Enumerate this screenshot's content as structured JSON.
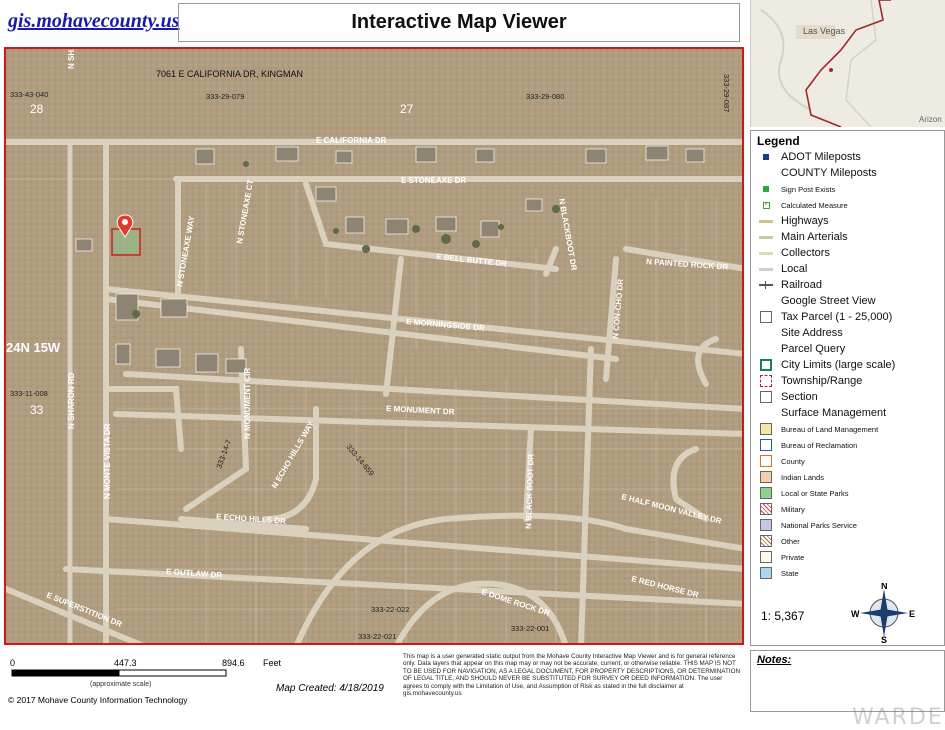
{
  "header": {
    "site_link": "gis.mohavecounty.us",
    "title": "Interactive Map Viewer"
  },
  "inset": {
    "city_label": "Las Vegas",
    "town_label": "Arizon"
  },
  "map": {
    "address": "7061 E CALIFORNIA DR, KINGMAN",
    "township": "24N 15W",
    "sections": [
      "28",
      "27",
      "33"
    ],
    "parcels": [
      "333-43-040",
      "333-29-079",
      "333-29-080",
      "333-29-087",
      "333-11-008",
      "333-14-7",
      "333-14-659",
      "333-22-022",
      "333-22-021",
      "333-22-001"
    ],
    "streets": [
      "E CALIFORNIA DR",
      "E STONEAXE DR",
      "E BELL BUTTE DR",
      "N PAINTED ROCK DR",
      "E MORNINGSIDE DR",
      "E MONUMENT DR",
      "E HALF MOON VALLEY DR",
      "E ECHO HILLS DR",
      "E OUTLAW DR",
      "E SUPERSTITION DR",
      "E RED HORSE DR",
      "E DOME ROCK DR",
      "N SHARON RD",
      "N MONTE VISTA DR",
      "N STONEAXE WAY",
      "N STONEAXE CT",
      "N BLACKBOOT DR",
      "N CON-CHO DR",
      "N MONUMENT CIR",
      "N ECHO HILLS WAY",
      "N BLACK BOOT DR"
    ]
  },
  "legend": {
    "title": "Legend",
    "items": [
      {
        "label": "ADOT Mileposts",
        "sym": "sq-blue",
        "size": "normal"
      },
      {
        "label": "COUNTY Mileposts",
        "sym": "none",
        "size": "normal"
      },
      {
        "label": "Sign Post Exists",
        "sym": "sq-green",
        "size": "small"
      },
      {
        "label": "Calculated Measure",
        "sym": "sq-green-x",
        "size": "small"
      },
      {
        "label": "Highways",
        "sym": "line-olive",
        "size": "normal"
      },
      {
        "label": "Main Arterials",
        "sym": "line-olive2",
        "size": "normal"
      },
      {
        "label": "Collectors",
        "sym": "line-lgreen",
        "size": "normal"
      },
      {
        "label": "Local",
        "sym": "line-gray",
        "size": "normal"
      },
      {
        "label": "Railroad",
        "sym": "line-rail",
        "size": "normal"
      },
      {
        "label": "Google Street View",
        "sym": "none",
        "size": "normal"
      },
      {
        "label": "Tax Parcel (1 - 25,000)",
        "sym": "box-gray",
        "size": "normal"
      },
      {
        "label": "Site Address",
        "sym": "none",
        "size": "normal"
      },
      {
        "label": "Parcel Query",
        "sym": "none",
        "size": "normal"
      },
      {
        "label": "City Limits (large scale)",
        "sym": "box-teal",
        "size": "normal"
      },
      {
        "label": "Township/Range",
        "sym": "box-red-dash",
        "size": "normal"
      },
      {
        "label": "Section",
        "sym": "box-gray",
        "size": "normal"
      },
      {
        "label": "Surface Management",
        "sym": "none",
        "size": "normal"
      },
      {
        "label": "Bureau of Land Management",
        "sym": "fill-yellow",
        "size": "small"
      },
      {
        "label": "Bureau of Reclamation",
        "sym": "fill-blue-outline",
        "size": "small"
      },
      {
        "label": "County",
        "sym": "fill-orange-outline",
        "size": "small"
      },
      {
        "label": "Indian Lands",
        "sym": "fill-peach",
        "size": "small"
      },
      {
        "label": "Local or State Parks",
        "sym": "fill-green",
        "size": "small"
      },
      {
        "label": "Military",
        "sym": "fill-red-hatch",
        "size": "small"
      },
      {
        "label": "National Parks Service",
        "sym": "fill-lavender",
        "size": "small"
      },
      {
        "label": "Other",
        "sym": "fill-brown-hatch",
        "size": "small"
      },
      {
        "label": "Private",
        "sym": "fill-white",
        "size": "small"
      },
      {
        "label": "State",
        "sym": "fill-lightblue",
        "size": "small"
      }
    ],
    "scale_ratio": "1: 5,367",
    "compass": {
      "n": "N",
      "s": "S",
      "e": "E",
      "w": "W"
    }
  },
  "scalebar": {
    "labels": [
      "0",
      "447.3",
      "894.6"
    ],
    "unit": "Feet",
    "note": "(approximate scale)"
  },
  "footer": {
    "copyright": "© 2017 Mohave County Information Technology",
    "map_created": "Map Created: 4/18/2019",
    "disclaimer": "This map is a user generated static output from the Mohave County Interactive Map Viewer and is for general reference only. Data layers that appear on this map may or may not be accurate, current, or otherwise reliable. THIS MAP IS NOT TO BE USED FOR NAVIGATION, AS A LEGAL DOCUMENT, FOR PROPERTY DESCRIPTIONS, OR DETERMINATION OF LEGAL TITLE, AND SHOULD NEVER BE SUBSTITUTED FOR SURVEY OR DEED INFORMATION. The user agrees to comply with the Limitation of Use, and Assumption of Risk as stated in the full disclaimer at gis.mohavecounty.us",
    "notes_label": "Notes:",
    "watermark": "WARDEX"
  }
}
